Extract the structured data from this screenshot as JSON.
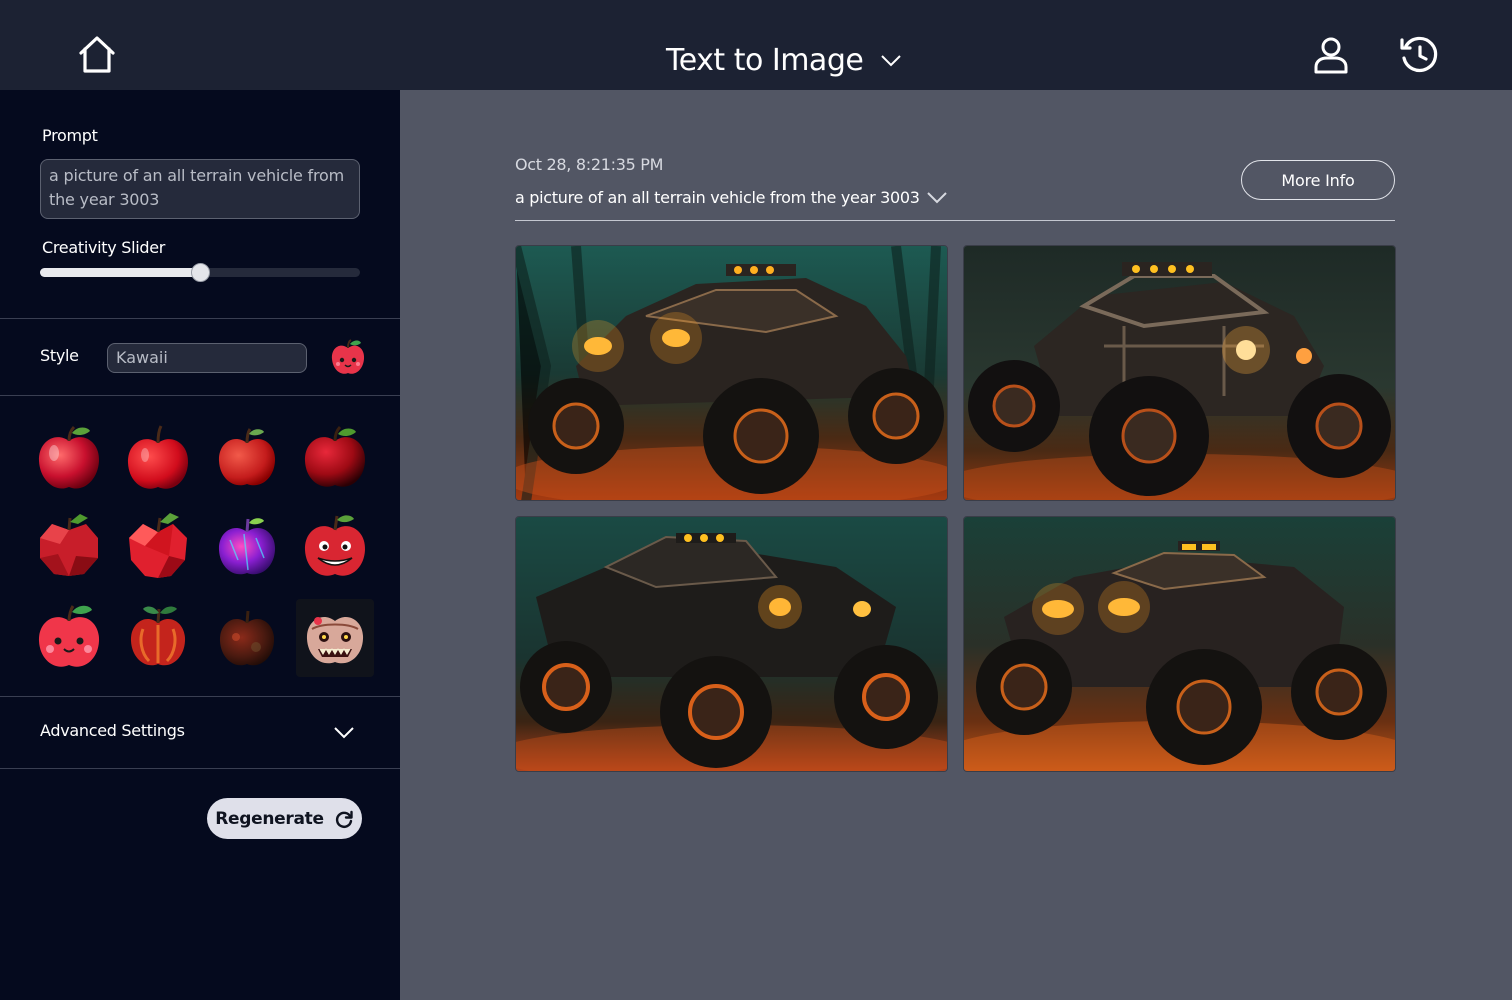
{
  "header": {
    "title": "Text to Image"
  },
  "sidebar": {
    "prompt_label": "Prompt",
    "prompt_value": "a picture of an all terrain vehicle from the year 3003",
    "slider_label": "Creativity Slider",
    "slider_value": 0.5,
    "style_label": "Style",
    "style_value": "Kawaii",
    "style_options": [
      {
        "variant": "glossy-red-apple",
        "selected": false
      },
      {
        "variant": "bright-red-apple",
        "selected": false
      },
      {
        "variant": "classic-red-apple",
        "selected": false
      },
      {
        "variant": "dark-red-apple",
        "selected": false
      },
      {
        "variant": "low-poly-apple",
        "selected": false
      },
      {
        "variant": "faceted-red-apple",
        "selected": false
      },
      {
        "variant": "neon-purple-apple",
        "selected": false
      },
      {
        "variant": "grinning-apple",
        "selected": false
      },
      {
        "variant": "kawaii-apple",
        "selected": true
      },
      {
        "variant": "stylized-apple",
        "selected": false
      },
      {
        "variant": "rotten-apple",
        "selected": false
      },
      {
        "variant": "monster-apple",
        "selected": false
      }
    ],
    "advanced_label": "Advanced Settings",
    "regenerate_label": "Regenerate"
  },
  "main": {
    "timestamp": "Oct 28, 8:21:35 PM",
    "prompt": "a picture of an all terrain vehicle from the year 3003",
    "more_info_label": "More Info",
    "images": [
      {
        "subject": "monster-truck-headlights"
      },
      {
        "subject": "monster-truck-roll-cage"
      },
      {
        "subject": "monster-truck-side-view"
      },
      {
        "subject": "monster-truck-front-view"
      }
    ]
  },
  "colors": {
    "header_bg": "#1c2233",
    "sidebar_bg": "#050a1e",
    "main_bg": "#525664",
    "button_bg": "#dfe0ea"
  }
}
